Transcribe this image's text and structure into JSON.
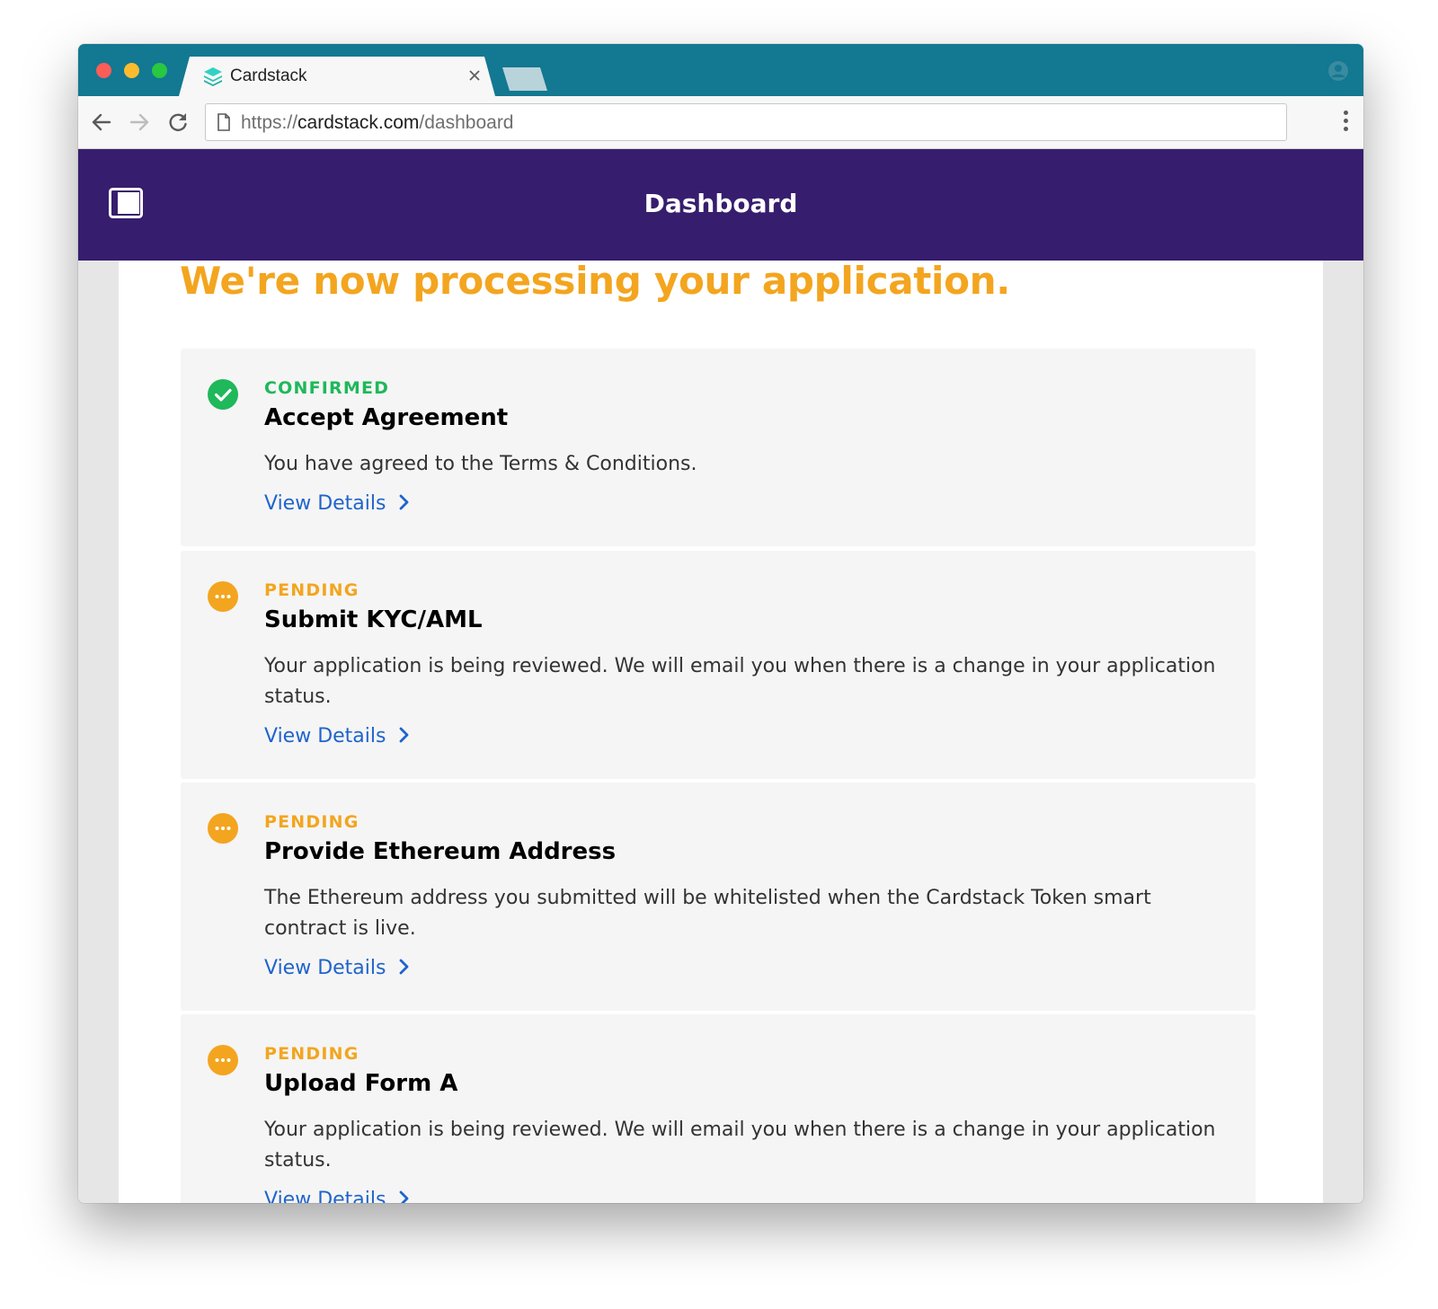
{
  "browser": {
    "tab_title": "Cardstack",
    "url_scheme": "https://",
    "url_host": "cardstack.com",
    "url_path": "/dashboard"
  },
  "header": {
    "title": "Dashboard"
  },
  "page": {
    "heading": "We're now processing your application."
  },
  "colors": {
    "browser_frame": "#137891",
    "header_bg": "#371d6e",
    "heading": "#f3a51f",
    "confirmed": "#1fb85a",
    "pending": "#f3a51f",
    "link": "#1f64cc"
  },
  "cards": [
    {
      "status": "CONFIRMED",
      "status_icon": "check-circle-icon",
      "title": "Accept Agreement",
      "description": "You have agreed to the Terms & Conditions.",
      "link_label": "View Details"
    },
    {
      "status": "PENDING",
      "status_icon": "pending-dots-icon",
      "title": "Submit KYC/AML",
      "description": "Your application is being reviewed. We will email you when there is a change in your application status.",
      "link_label": "View Details"
    },
    {
      "status": "PENDING",
      "status_icon": "pending-dots-icon",
      "title": "Provide Ethereum Address",
      "description": "The Ethereum address you submitted will be whitelisted when the Cardstack Token smart contract is live.",
      "link_label": "View Details"
    },
    {
      "status": "PENDING",
      "status_icon": "pending-dots-icon",
      "title": "Upload Form A",
      "description": "Your application is being reviewed. We will email you when there is a change in your application status.",
      "link_label": "View Details"
    }
  ]
}
